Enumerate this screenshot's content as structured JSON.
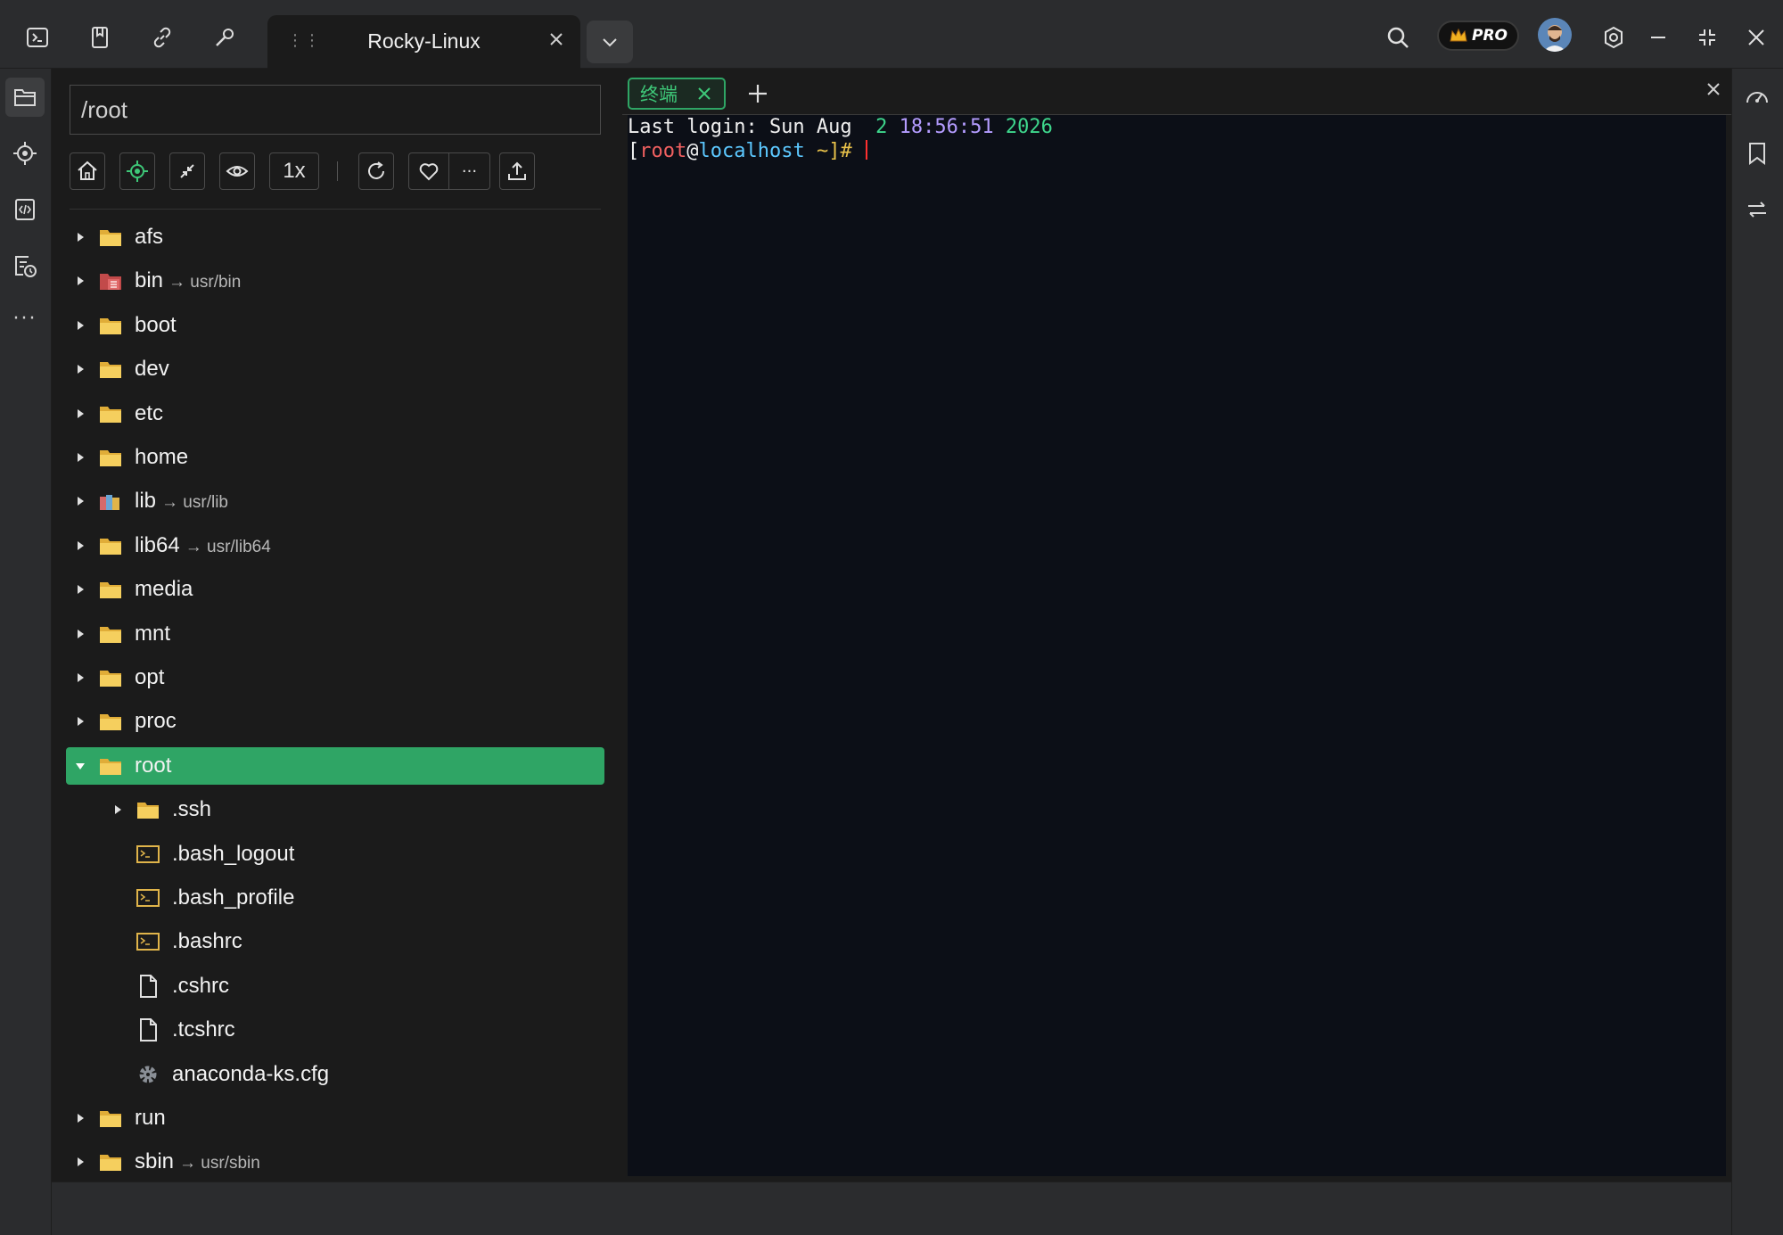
{
  "window": {
    "session_tab_title": "Rocky-Linux",
    "pro_badge": "PRO"
  },
  "colors": {
    "accent_green": "#2fa565",
    "folder_yellow": "#f0c24b",
    "terminal_bg": "#0c0f17"
  },
  "titlebar": {
    "left_icons": [
      "terminal-icon",
      "bookmark-icon",
      "link-icon",
      "wrench-icon"
    ],
    "right_icons": [
      "search-icon",
      "pro-crown-icon",
      "avatar",
      "settings-icon",
      "minimize-icon",
      "restore-icon",
      "close-icon"
    ]
  },
  "sidebar": {
    "items": [
      "folder-icon",
      "crosshair-icon",
      "code-file-icon",
      "history-icon",
      "more-icon"
    ]
  },
  "file_panel": {
    "path": "/root",
    "toolbar": {
      "zoom_label": "1x",
      "more_label": "···"
    },
    "tree": [
      {
        "name": "afs",
        "type": "folder",
        "depth": 0,
        "expanded": false
      },
      {
        "name": "bin",
        "link": "→ usr/bin",
        "type": "link-folder-red",
        "depth": 0,
        "expanded": false
      },
      {
        "name": "boot",
        "type": "folder",
        "depth": 0,
        "expanded": false
      },
      {
        "name": "dev",
        "type": "folder",
        "depth": 0,
        "expanded": false
      },
      {
        "name": "etc",
        "type": "folder",
        "depth": 0,
        "expanded": false
      },
      {
        "name": "home",
        "type": "folder",
        "depth": 0,
        "expanded": false
      },
      {
        "name": "lib",
        "link": "→ usr/lib",
        "type": "link-folder-multi",
        "depth": 0,
        "expanded": false
      },
      {
        "name": "lib64",
        "link": "→ usr/lib64",
        "type": "folder",
        "depth": 0,
        "expanded": false
      },
      {
        "name": "media",
        "type": "folder",
        "depth": 0,
        "expanded": false
      },
      {
        "name": "mnt",
        "type": "folder",
        "depth": 0,
        "expanded": false
      },
      {
        "name": "opt",
        "type": "folder",
        "depth": 0,
        "expanded": false
      },
      {
        "name": "proc",
        "type": "folder",
        "depth": 0,
        "expanded": false
      },
      {
        "name": "root",
        "type": "folder",
        "depth": 0,
        "expanded": true,
        "selected": true
      },
      {
        "name": ".ssh",
        "type": "folder",
        "depth": 1,
        "expanded": false
      },
      {
        "name": ".bash_logout",
        "type": "script",
        "depth": 1
      },
      {
        "name": ".bash_profile",
        "type": "script",
        "depth": 1
      },
      {
        "name": ".bashrc",
        "type": "script",
        "depth": 1
      },
      {
        "name": ".cshrc",
        "type": "file",
        "depth": 1
      },
      {
        "name": ".tcshrc",
        "type": "file",
        "depth": 1
      },
      {
        "name": "anaconda-ks.cfg",
        "type": "config",
        "depth": 1
      },
      {
        "name": "run",
        "type": "folder",
        "depth": 0,
        "expanded": false
      },
      {
        "name": "sbin",
        "link": "→ usr/sbin",
        "type": "folder",
        "depth": 0,
        "expanded": false
      }
    ]
  },
  "terminal": {
    "tab_label": "终端",
    "line1": {
      "prefix": "Last login: Sun Aug  ",
      "day": "2",
      "time": "18:56:51",
      "year": "2026"
    },
    "line2": {
      "open": "[",
      "user": "root",
      "at": "@",
      "host": "localhost",
      "dir": " ~",
      "close": "]#"
    }
  },
  "rightbar": {
    "items": [
      "dashboard-icon",
      "bookmark-icon",
      "transfer-icon"
    ]
  }
}
